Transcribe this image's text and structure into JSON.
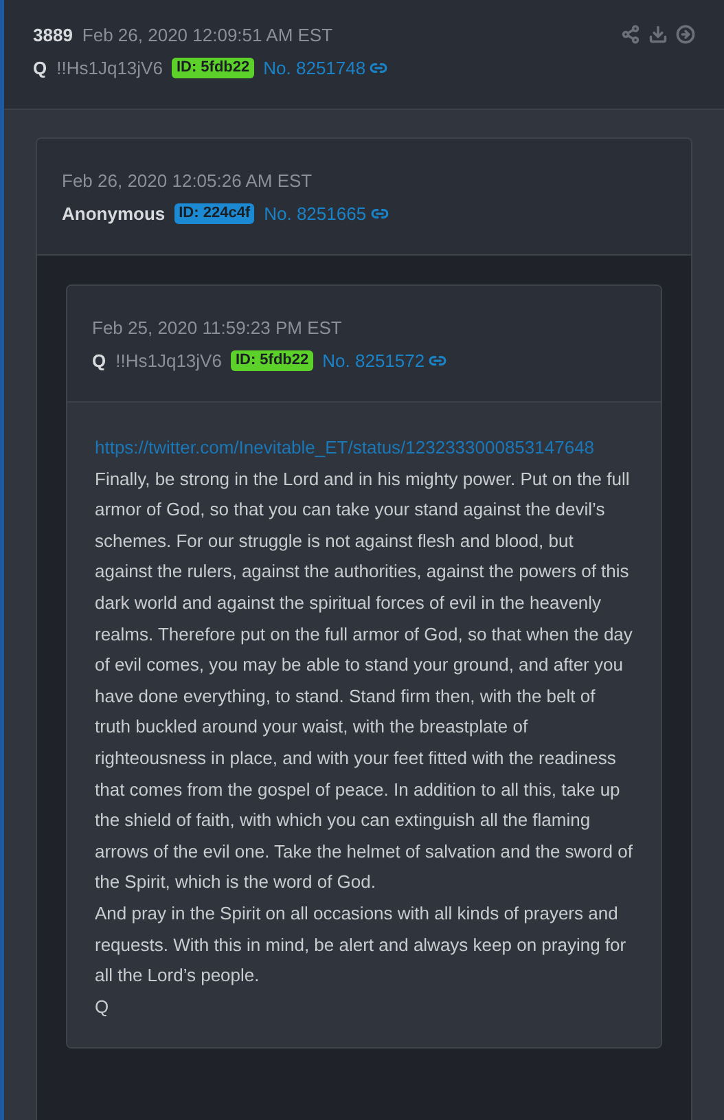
{
  "post": {
    "number": "3889",
    "date": "Feb 26, 2020 12:09:51 AM EST",
    "name": "Q",
    "tripcode": "!!Hs1Jq13jV6",
    "id_badge": {
      "label": "ID: 5fdb22",
      "color": "#5bd12a"
    },
    "post_no": "No. 8251748"
  },
  "quoted": {
    "date": "Feb 26, 2020 12:05:26 AM EST",
    "name": "Anonymous",
    "id_badge": {
      "label": "ID: 224c4f",
      "color": "#1c8ad3"
    },
    "post_no": "No. 8251665",
    "quoted": {
      "date": "Feb 25, 2020 11:59:23 PM EST",
      "name": "Q",
      "tripcode": "!!Hs1Jq13jV6",
      "id_badge": {
        "label": "ID: 5fdb22",
        "color": "#5bd12a"
      },
      "post_no": "No. 8251572",
      "body": [
        {
          "kind": "link",
          "text": "https://twitter.com/Inevitable_ET/status/1232333000853147648"
        },
        {
          "kind": "text",
          "text": "Finally, be strong in the Lord and in his mighty power. Put on the full armor of God, so that you can take your stand against the devil’s schemes. For our struggle is not against flesh and blood, but against the rulers, against the authorities, against the powers of this dark world and against the spiritual forces of evil in the heavenly realms. Therefore put on the full armor of God, so that when the day of evil comes, you may be able to stand your ground, and after you have done everything, to stand. Stand firm then, with the belt of truth buckled around your waist, with the breastplate of righteousness in place, and with your feet fitted with the readiness that comes from the gospel of peace. In addition to all this, take up the shield of faith, with which you can extinguish all the flaming arrows of the evil one. Take the helmet of salvation and the sword of the Spirit, which is the word of God."
        },
        {
          "kind": "text",
          "text": "And pray in the Spirit on all occasions with all kinds of prayers and requests. With this in mind, be alert and always keep on praying for all the Lord’s people."
        },
        {
          "kind": "text",
          "text": "Q"
        }
      ]
    }
  }
}
